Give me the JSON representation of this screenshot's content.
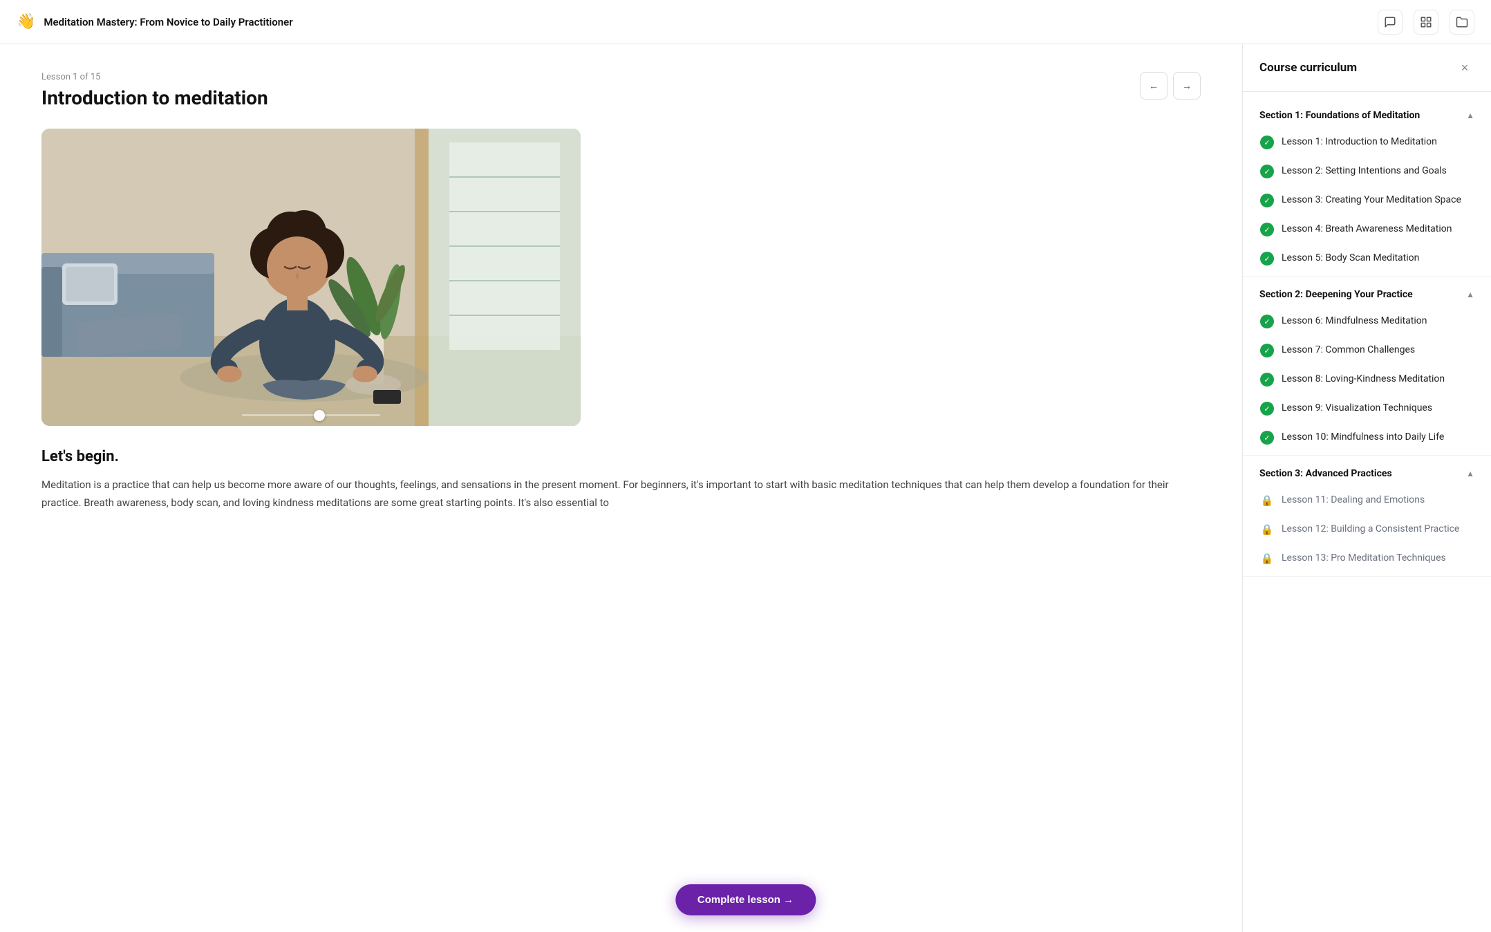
{
  "header": {
    "logo_emoji": "👋",
    "title": "Meditation Mastery: From Novice to Daily Practitioner",
    "icons": [
      {
        "name": "chat-icon",
        "symbol": "💬"
      },
      {
        "name": "grid-icon",
        "symbol": "⊞"
      },
      {
        "name": "folder-icon",
        "symbol": "📁"
      }
    ]
  },
  "lesson": {
    "meta": "Lesson 1 of 15",
    "title": "Introduction to meditation",
    "section_heading": "Let's begin.",
    "body_text": "Meditation is a practice that can help us become more aware of our thoughts, feelings, and sensations in the present moment. For beginners, it's important to start with basic meditation techniques that can help them develop a foundation for their practice. Breath awareness, body scan, and loving kindness meditations are some great starting points. It's also essential to"
  },
  "nav": {
    "prev_label": "←",
    "next_label": "→"
  },
  "complete_btn": {
    "label": "Complete lesson →"
  },
  "sidebar": {
    "title": "Course curriculum",
    "close_label": "×",
    "sections": [
      {
        "id": "section-1",
        "label": "Section 1: Foundations of Meditation",
        "expanded": true,
        "lessons": [
          {
            "id": "l1",
            "label": "Lesson 1: Introduction to Meditation",
            "status": "complete"
          },
          {
            "id": "l2",
            "label": "Lesson 2: Setting Intentions and Goals",
            "status": "complete"
          },
          {
            "id": "l3",
            "label": "Lesson 3: Creating Your Meditation Space",
            "status": "complete"
          },
          {
            "id": "l4",
            "label": "Lesson 4: Breath Awareness Meditation",
            "status": "complete"
          },
          {
            "id": "l5",
            "label": "Lesson 5: Body Scan Meditation",
            "status": "complete"
          }
        ]
      },
      {
        "id": "section-2",
        "label": "Section 2: Deepening Your Practice",
        "expanded": true,
        "lessons": [
          {
            "id": "l6",
            "label": "Lesson 6: Mindfulness Meditation",
            "status": "complete"
          },
          {
            "id": "l7",
            "label": "Lesson 7: Common Challenges",
            "status": "complete"
          },
          {
            "id": "l8",
            "label": "Lesson 8: Loving-Kindness Meditation",
            "status": "complete"
          },
          {
            "id": "l9",
            "label": "Lesson 9: Visualization Techniques",
            "status": "complete"
          },
          {
            "id": "l10",
            "label": "Lesson 10: Mindfulness into Daily Life",
            "status": "complete"
          }
        ]
      },
      {
        "id": "section-3",
        "label": "Section 3: Advanced Practices",
        "expanded": true,
        "lessons": [
          {
            "id": "l11",
            "label": "Lesson 11: Dealing and Emotions",
            "status": "locked"
          },
          {
            "id": "l12",
            "label": "Lesson 12: Building a Consistent Practice",
            "status": "locked"
          },
          {
            "id": "l13",
            "label": "Lesson 13: Pro Meditation Techniques",
            "status": "locked"
          }
        ]
      }
    ]
  }
}
